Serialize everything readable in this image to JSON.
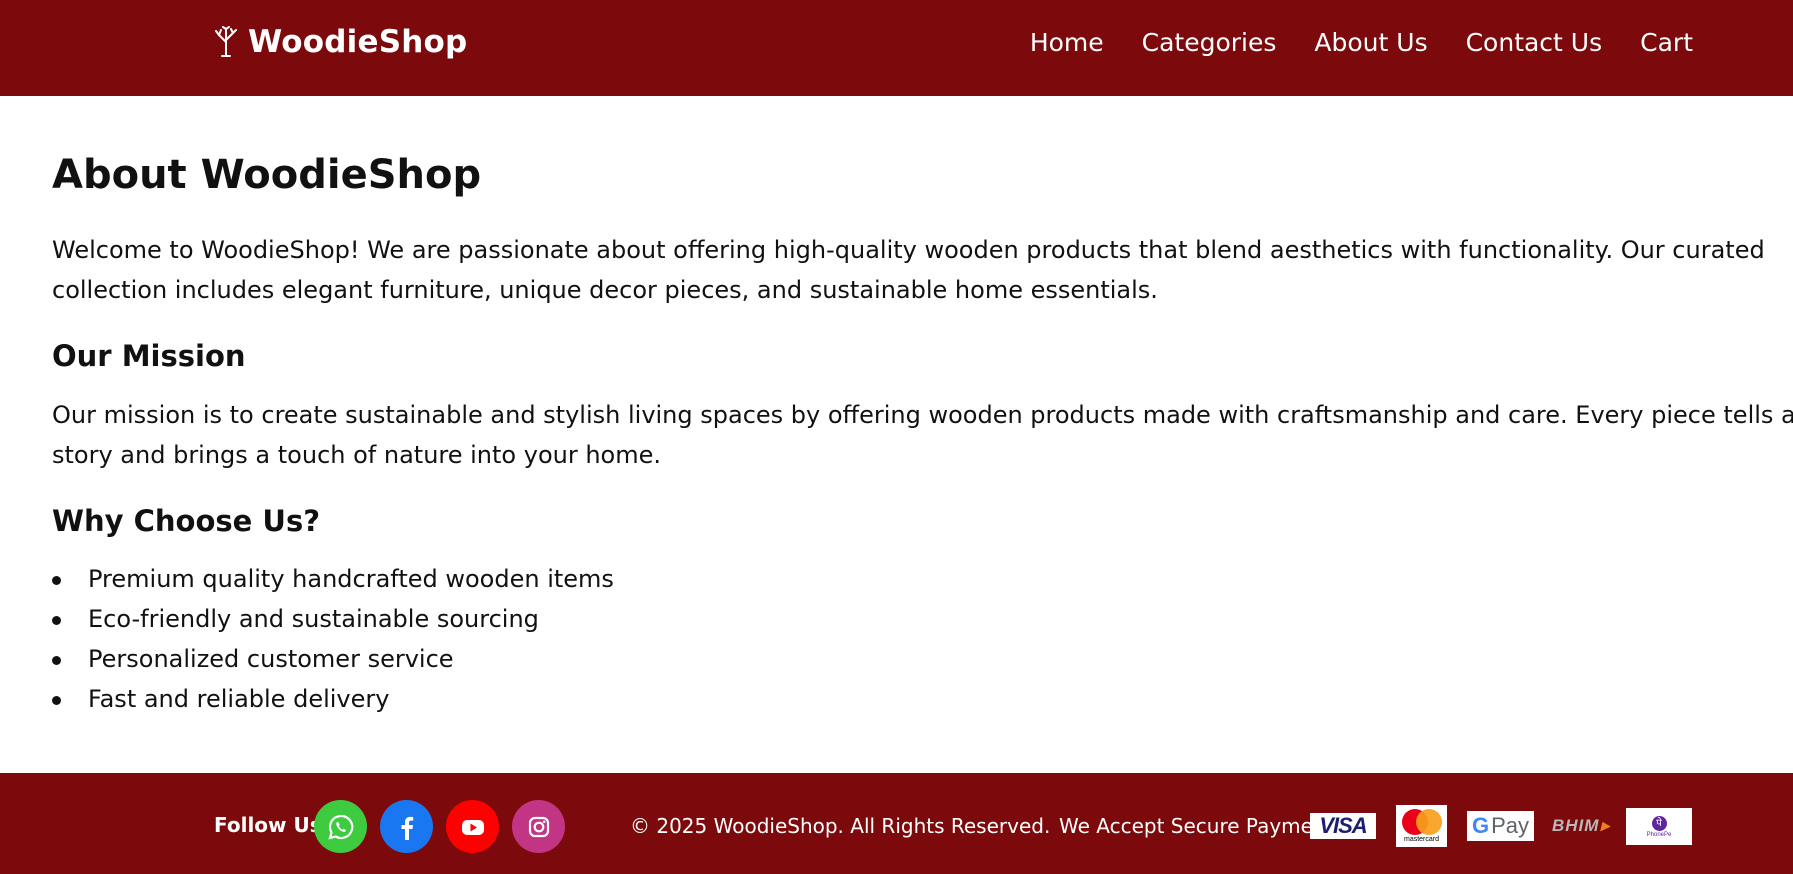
{
  "brand": {
    "name": "WoodieShop",
    "icon": "tree-icon"
  },
  "nav": {
    "items": [
      {
        "label": "Home"
      },
      {
        "label": "Categories"
      },
      {
        "label": "About Us"
      },
      {
        "label": "Contact Us"
      },
      {
        "label": "Cart"
      }
    ]
  },
  "main": {
    "title": "About WoodieShop",
    "intro": "Welcome to WoodieShop! We are passionate about offering high-quality wooden products that blend aesthetics with functionality. Our curated collection includes elegant furniture, unique decor pieces, and sustainable home essentials.",
    "mission_heading": "Our Mission",
    "mission_text": "Our mission is to create sustainable and stylish living spaces by offering wooden products made with craftsmanship and care. Every piece tells a story and brings a touch of nature into your home.",
    "why_heading": "Why Choose Us?",
    "why_items": [
      "Premium quality handcrafted wooden items",
      "Eco-friendly and sustainable sourcing",
      "Personalized customer service",
      "Fast and reliable delivery"
    ]
  },
  "footer": {
    "follow_label": "Follow Us",
    "social": [
      {
        "name": "whatsapp-icon",
        "color": "#3ecb40"
      },
      {
        "name": "facebook-icon",
        "color": "#1a77f2"
      },
      {
        "name": "youtube-icon",
        "color": "#ff0000"
      },
      {
        "name": "instagram-icon",
        "color": "#c13584"
      }
    ],
    "copyright": "© 2025 WoodieShop. All Rights Reserved.",
    "payment_label": "We Accept Secure Payment",
    "payment_logos": {
      "visa": "VISA",
      "mastercard": "mastercard",
      "gpay_g": "G",
      "gpay_text": "Pay",
      "bhim": "BHIM",
      "phonepe_symbol": "पे",
      "phonepe": "PhonePe"
    }
  },
  "colors": {
    "brand_maroon": "#7c0a0c",
    "text": "#111111",
    "background": "#ffffff"
  }
}
